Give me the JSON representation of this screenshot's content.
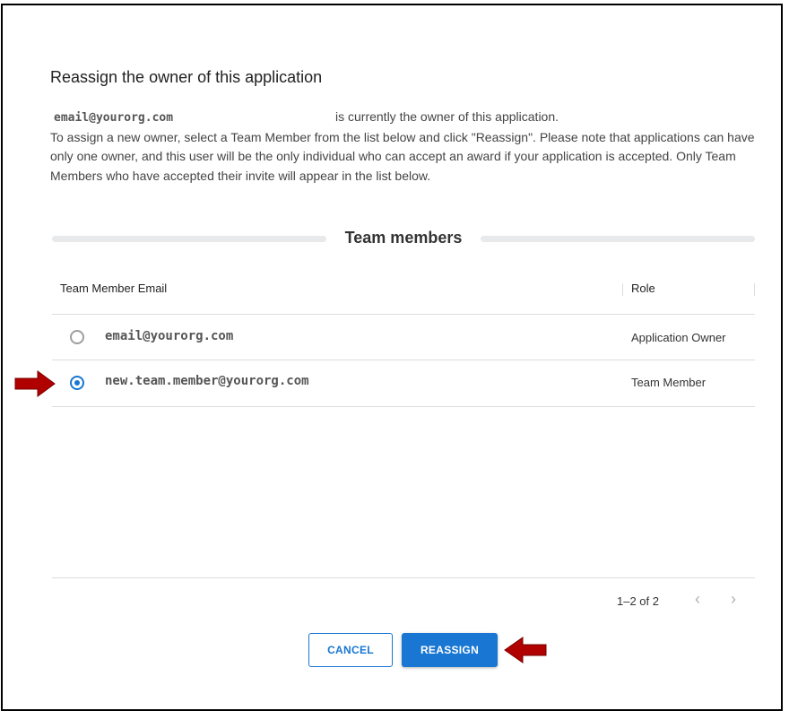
{
  "dialog": {
    "title": "Reassign the owner of this application",
    "current_owner_email": "email@yourorg.com",
    "current_owner_suffix": "is currently the owner of this application.",
    "instructions": "To assign a new owner, select a Team Member from the list below and click \"Reassign\". Please note that applications can have only one owner, and this user will be the only individual who can accept an award if your application is accepted. Only Team Members who have accepted their invite will appear in the list below.",
    "section_label": "Team members"
  },
  "table": {
    "headers": {
      "email": "Team Member Email",
      "role": "Role"
    },
    "rows": [
      {
        "email": "email@yourorg.com",
        "role": "Application Owner",
        "selected": false
      },
      {
        "email": "new.team.member@yourorg.com",
        "role": "Team Member",
        "selected": true
      }
    ]
  },
  "pagination": {
    "range_text": "1–2 of 2",
    "prev_icon": "chevron-left-icon",
    "next_icon": "chevron-right-icon"
  },
  "actions": {
    "cancel_label": "CANCEL",
    "reassign_label": "REASSIGN"
  },
  "colors": {
    "primary": "#1976d2",
    "annotation_arrow": "#b00000"
  }
}
